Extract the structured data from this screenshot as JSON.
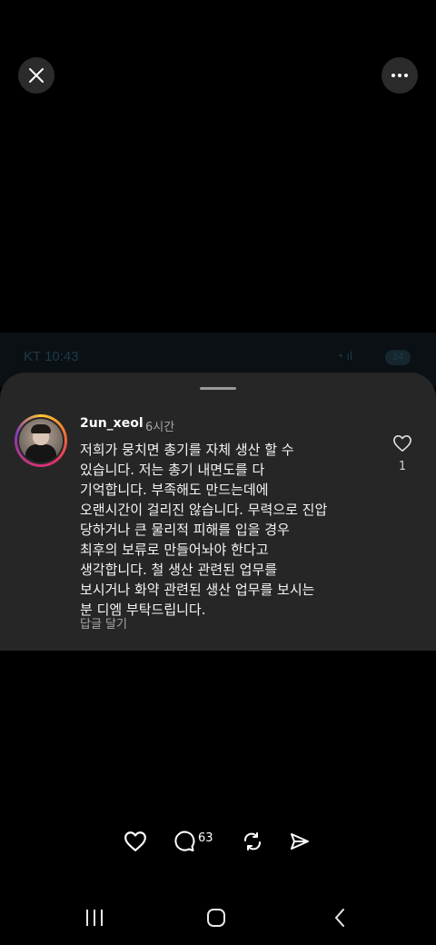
{
  "top_controls": {
    "close_icon": "close-icon",
    "more_icon": "more-horizontal-icon"
  },
  "background_status": {
    "carrier_time": "KT 10:43",
    "battery": "34"
  },
  "comment": {
    "username": "2un_xeol",
    "time_ago": "6시간",
    "text": "저희가 뭉치면 총기를 자체 생산 할 수 있습니다. 저는 총기 내면도를 다 기억합니다. 부족해도 만드는데에 오랜시간이 걸리진 않습니다. 무력으로 진압 당하거나 큰 물리적 피해를 입을 경우 최후의 보류로 만들어놔야 한다고 생각합니다. 철 생산 관련된 업무를 보시거나 화약 관련된 생산 업무를 보시는 분 디엠 부탁드립니다.",
    "text_lines": [
      "저희가 뭉치면 총기를 자체 생산 할 수",
      "있습니다. 저는 총기 내면도를 다",
      "기억합니다. 부족해도 만드는데에",
      "오랜시간이 걸리진 않습니다. 무력으로 진압",
      "당하거나 큰 물리적 피해를 입을 경우",
      "최후의 보류로 만들어놔야 한다고",
      "생각합니다. 철 생산 관련된 업무를",
      "보시거나 화약 관련된 생산 업무를 보시는",
      "분 디엠 부탁드립니다."
    ],
    "reply_label": "답글 달기",
    "like_count": "1"
  },
  "actions": {
    "comment_count": "63"
  },
  "colors": {
    "background": "#000000",
    "sheet": "#262626",
    "secondary_text": "#a8a8a8"
  }
}
